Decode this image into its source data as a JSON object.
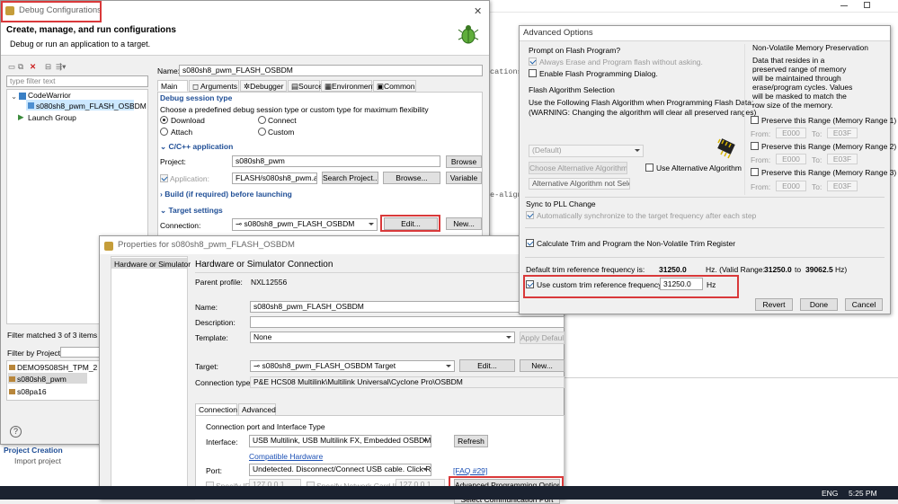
{
  "taskbar": {
    "lang": "ENG",
    "time": "5:25 PM"
  },
  "behind": {
    "code1": "cations",
    "code2": "e-align",
    "project_creation": "Project Creation",
    "import_project": "Import project"
  },
  "debug": {
    "title": "Debug Configurations",
    "header_title": "Create, manage, and run configurations",
    "header_subtitle": "Debug or run an application to a target.",
    "filter_placeholder": "type filter text",
    "tree": {
      "root": "CodeWarrior",
      "child": "s080sh8_pwm_FLASH_OSBDM",
      "launch": "Launch Group"
    },
    "filter_status": "Filter matched 3 of 3 items",
    "filter_by_project": "Filter by Project:",
    "projects": [
      "DEMO9S08SH_TPM_2",
      "s080sh8_pwm",
      "s08pa16"
    ],
    "help": "?",
    "name_label": "Name:",
    "name_value": "s080sh8_pwm_FLASH_OSBDM",
    "tabs": [
      "Main",
      "Arguments",
      "Debugger",
      "Source",
      "Environment",
      "Common"
    ],
    "session_section": "Debug session type",
    "session_desc": "Choose a predefined debug session type or custom type for maximum flexibility",
    "radios": [
      "Download",
      "Connect",
      "Attach",
      "Custom"
    ],
    "cpp_section": "C/C++ application",
    "project_label": "Project:",
    "project_value": "s080sh8_pwm",
    "browse": "Browse",
    "application_label": "Application:",
    "application_value": "FLASH/s080sh8_pwm.abs",
    "search_project": "Search Project...",
    "browse2": "Browse...",
    "variables": "Variable",
    "build_section": "Build (if required) before launching",
    "target_section": "Target settings",
    "connection_label": "Connection:",
    "connection_value": "s080sh8_pwm_FLASH_OSBDM",
    "edit": "Edit...",
    "new": "New..."
  },
  "props": {
    "title": "Properties for s080sh8_pwm_FLASH_OSBDM",
    "left_item": "Hardware or Simulator",
    "heading": "Hardware or Simulator Connection",
    "parent_label": "Parent profile:",
    "parent_value": "NXL12556",
    "name_label": "Name:",
    "name_value": "s080sh8_pwm_FLASH_OSBDM",
    "desc_label": "Description:",
    "template_label": "Template:",
    "template_value": "None",
    "apply_default": "Apply Default",
    "target_label": "Target:",
    "target_value": "s080sh8_pwm_FLASH_OSBDM Target",
    "edit": "Edit...",
    "new": "New...",
    "conn_type_label": "Connection type:",
    "conn_type_value": "P&E HCS08 Multilink\\Multilink Universal\\Cyclone Pro\\OSBDM",
    "tabs": [
      "Connection",
      "Advanced"
    ],
    "port_group": "Connection port and Interface Type",
    "interface_label": "Interface:",
    "interface_value": "USB Multilink, USB Multilink FX, Embedded OSBDM/OSJTAG - USB Port",
    "refresh": "Refresh",
    "compat_link": "Compatible Hardware",
    "port_label": "Port:",
    "port_value": "Undetected. Disconnect/Connect USB cable. Click Refresh",
    "faq": "[FAQ #29]",
    "specify_ip": "Specify IP",
    "ip_value": "127.0.0.1",
    "specify_nc": "Specify Network Card IP",
    "nc_value": "127.0.0.1",
    "adv_prog": "Advanced Programming Options",
    "bottom_btn": "Select Communication Port"
  },
  "adv": {
    "title": "Advanced Options",
    "prompt_header": "Prompt on Flash Program?",
    "always_erase": "Always Erase and Program flash without asking.",
    "enable_dialog": "Enable Flash Programming Dialog.",
    "flash_algo_header": "Flash Algorithm Selection",
    "flash_algo_desc1": "Use the Following Flash Algorithm when Programming Flash Data:",
    "flash_algo_desc2": "(WARNING: Changing the algorithm will clear all preserved ranges)",
    "algo_select": "(Default)",
    "choose_alt": "Choose Alternative Algorithm",
    "alt_not_selected": "Alternative Algorithm not Selected",
    "use_alt": "Use Alternative Algorithm",
    "nvm_header": "Non-Volatile Memory Preservation",
    "nvm_desc": [
      "Data that resides in a",
      "preserved range of memory",
      "will be maintained through",
      "erase/program cycles. Values",
      "will be masked to match the",
      "row size of the memory."
    ],
    "ranges": [
      {
        "label": "Preserve this Range (Memory Range 1)",
        "from": "E000",
        "to": "E03F"
      },
      {
        "label": "Preserve this Range (Memory Range 2)",
        "from": "E000",
        "to": "E03F"
      },
      {
        "label": "Preserve this Range (Memory Range 3)",
        "from": "E000",
        "to": "E03F"
      }
    ],
    "from_label": "From:",
    "to_label": "To:",
    "sync_header": "Sync to PLL Change",
    "sync_option": "Automatically synchronize to the target frequency after each step",
    "calc_trim": "Calculate Trim and Program the Non-Volatile Trim Register",
    "default_trim_label": "Default trim reference frequency is:",
    "default_trim_value": "31250.0",
    "valid_range_text": "Hz. (Valid Range:",
    "range_min": "31250.0",
    "range_to": "to",
    "range_max": "39062.5",
    "range_unit": "Hz)",
    "custom_trim_label": "Use custom trim reference frequency:",
    "custom_trim_value": "31250.0",
    "custom_unit": "Hz",
    "revert": "Revert",
    "done": "Done",
    "cancel": "Cancel"
  }
}
